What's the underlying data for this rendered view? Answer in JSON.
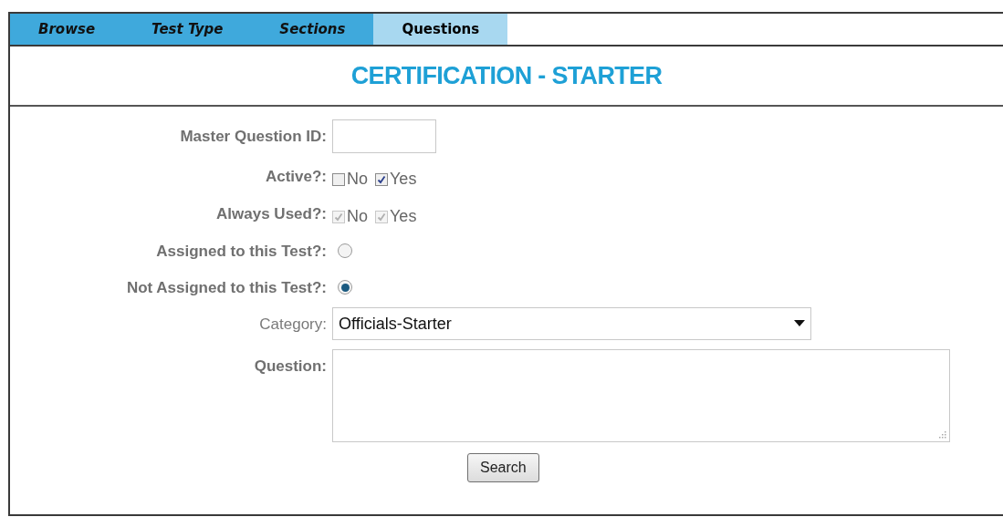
{
  "tabs": [
    {
      "label": "Browse",
      "selected": false
    },
    {
      "label": "Test Type",
      "selected": false
    },
    {
      "label": "Sections",
      "selected": false
    },
    {
      "label": "Questions",
      "selected": true
    }
  ],
  "title": "CERTIFICATION - STARTER",
  "fields": [
    {
      "kind": "text",
      "label": "Master Question ID:"
    },
    {
      "kind": "checks",
      "label": "Active?:",
      "options": [
        {
          "label": "No",
          "checked": false,
          "disabled": false
        },
        {
          "label": "Yes",
          "checked": true,
          "disabled": false
        }
      ]
    },
    {
      "kind": "checks",
      "label": "Always Used?:",
      "options": [
        {
          "label": "No",
          "checked": true,
          "disabled": true
        },
        {
          "label": "Yes",
          "checked": true,
          "disabled": true
        }
      ]
    },
    {
      "kind": "radio",
      "label": "Assigned to this Test?:",
      "selected": false
    },
    {
      "kind": "radio",
      "label": "Not Assigned to this Test?:",
      "selected": true
    },
    {
      "kind": "select",
      "label": "Category:",
      "value": "Officials-Starter"
    },
    {
      "kind": "textarea",
      "label": "Question:"
    }
  ],
  "button": "Search"
}
